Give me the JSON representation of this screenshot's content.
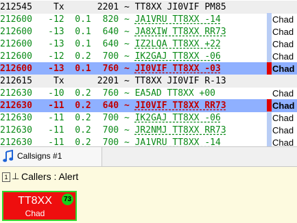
{
  "log": {
    "rows": [
      {
        "type": "hdr",
        "time": "212545",
        "db": "Tx",
        "dt": "",
        "freq": "2201",
        "sep": "~",
        "msg": "TT8XX JI0VIF PM85",
        "side": "",
        "marker": "none"
      },
      {
        "type": "norm",
        "time": "212600",
        "db": "-12",
        "dt": "0.1",
        "freq": "820",
        "sep": "~",
        "msg": "JA1VRU TT8XX -14",
        "side": "Chad",
        "marker": "blue"
      },
      {
        "type": "norm",
        "time": "212600",
        "db": "-13",
        "dt": "0.1",
        "freq": "640",
        "sep": "~",
        "msg": "JA8XIW TT8XX RR73",
        "side": "Chad",
        "marker": "blue"
      },
      {
        "type": "norm",
        "time": "212600",
        "db": "-13",
        "dt": "0.1",
        "freq": "640",
        "sep": "~",
        "msg": "IZ2LQA TT8XX +22",
        "side": "Chad",
        "marker": "blue"
      },
      {
        "type": "norm",
        "time": "212600",
        "db": "-12",
        "dt": "0.2",
        "freq": "700",
        "sep": "~",
        "msg": "IK2GAJ TT8XX -06",
        "side": "Chad",
        "marker": "blue"
      },
      {
        "type": "hl",
        "time": "212600",
        "db": "-13",
        "dt": "0.1",
        "freq": "760",
        "sep": "~",
        "msg": "JI0VIF TT8XX -03",
        "side": "Chad",
        "marker": "red"
      },
      {
        "type": "hdr",
        "time": "212615",
        "db": "Tx",
        "dt": "",
        "freq": "2201",
        "sep": "~",
        "msg": "TT8XX JI0VIF R-13",
        "side": "",
        "marker": "none"
      },
      {
        "type": "norm",
        "time": "212630",
        "db": "-10",
        "dt": "0.2",
        "freq": "760",
        "sep": "~",
        "msg": "EA5AD TT8XX +00",
        "side": "Chad",
        "marker": "none"
      },
      {
        "type": "hl",
        "time": "212630",
        "db": "-11",
        "dt": "0.2",
        "freq": "640",
        "sep": "~",
        "msg": "JI0VIF TT8XX RR73",
        "side": "Chad",
        "marker": "red"
      },
      {
        "type": "norm",
        "time": "212630",
        "db": "-11",
        "dt": "0.2",
        "freq": "700",
        "sep": "~",
        "msg": "IK2GAJ TT8XX -06",
        "side": "Chad",
        "marker": "blue"
      },
      {
        "type": "norm",
        "time": "212630",
        "db": "-11",
        "dt": "0.2",
        "freq": "700",
        "sep": "~",
        "msg": "JR2NMJ TT8XX RR73",
        "side": "Chad",
        "marker": "blue"
      },
      {
        "type": "norm",
        "time": "212630",
        "db": "-11",
        "dt": "0.2",
        "freq": "700",
        "sep": "~",
        "msg": "JA1VRU TT8XX -14",
        "side": "Chad",
        "marker": "blue"
      }
    ]
  },
  "tab": {
    "label": "Callsigns #1",
    "icon": "music-note-icon"
  },
  "panel": {
    "box_label": "1",
    "pin_icon": "pin-icon",
    "title": "Callers : Alert"
  },
  "card": {
    "callsign": "TT8XX",
    "country": "Chad",
    "badge": "73",
    "bg": "#ee0e0e",
    "border": "#2fd82f"
  }
}
